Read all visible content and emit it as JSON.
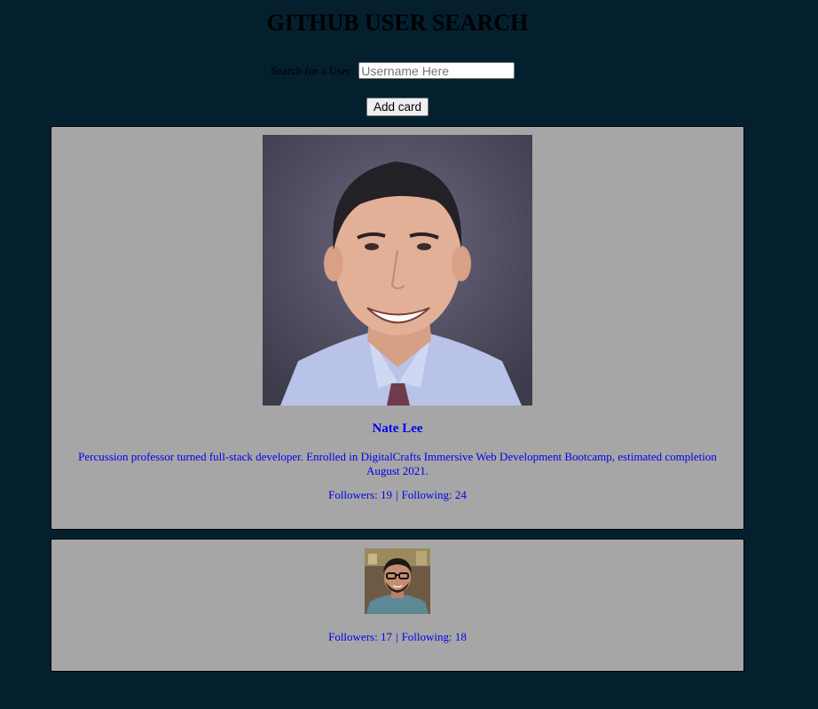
{
  "header": {
    "title": "GITHUB USER SEARCH"
  },
  "search": {
    "label": "Search for a User:",
    "placeholder": "Username Here",
    "value": ""
  },
  "actions": {
    "add_card_label": "Add card"
  },
  "cards": [
    {
      "name": "Nate Lee",
      "bio": "Percussion professor turned full-stack developer. Enrolled in DigitalCrafts Immersive Web Development Bootcamp, estimated completion August 2021.",
      "followers_label": "Followers: 19",
      "separator": "|",
      "following_label": "Following: 24"
    },
    {
      "name": "",
      "bio": "",
      "followers_label": "Followers: 17",
      "separator": "|",
      "following_label": "Following: 18"
    }
  ],
  "colors": {
    "page_background": "#04202e",
    "card_background": "#a6a6a6",
    "link_text": "#0000ee"
  }
}
